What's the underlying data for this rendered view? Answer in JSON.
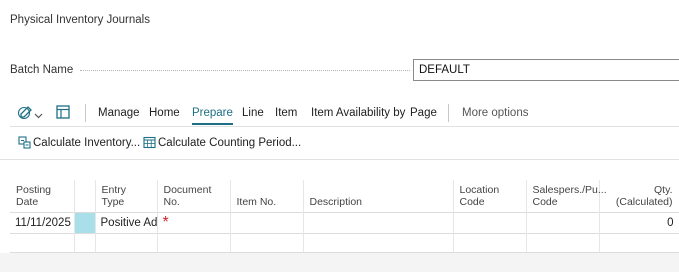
{
  "page": {
    "title": "Physical Inventory Journals"
  },
  "batch": {
    "label": "Batch Name",
    "value": "DEFAULT"
  },
  "actionbar": {
    "icon_a": "edit-list-icon",
    "icon_a_chevron": "chevron-down-icon",
    "icon_b": "open-in-excel-icon",
    "items": [
      "Manage",
      "Home",
      "Prepare",
      "Line",
      "Item",
      "Item Availability by",
      "Page"
    ],
    "active": "Prepare",
    "more": "More options"
  },
  "subactions": [
    {
      "icon": "calculate-inventory-icon",
      "label": "Calculate Inventory..."
    },
    {
      "icon": "calendar-icon",
      "label": "Calculate Counting Period..."
    }
  ],
  "grid": {
    "columns": [
      "Posting Date",
      "",
      "Entry Type",
      "Document No.",
      "Item No.",
      "Description",
      "Location Code",
      "Salespers./Pu... Code",
      "Qty. (Calculated)"
    ],
    "col_sales_line1": "Salespers./Pu...",
    "col_sales_line2": "Code",
    "col_qty_line1": "Qty.",
    "col_qty_line2": "(Calculated)",
    "rows": [
      {
        "posting_date": "11/11/2025",
        "entry_type": "Positive Ad...",
        "document_no": "*",
        "item_no": "",
        "description": "",
        "location_code": "",
        "salesperson": "",
        "qty": "0"
      }
    ]
  },
  "colors": {
    "accent": "#1d6f85",
    "selected_cell": "#a9dfe8",
    "required": "#d0252a"
  }
}
